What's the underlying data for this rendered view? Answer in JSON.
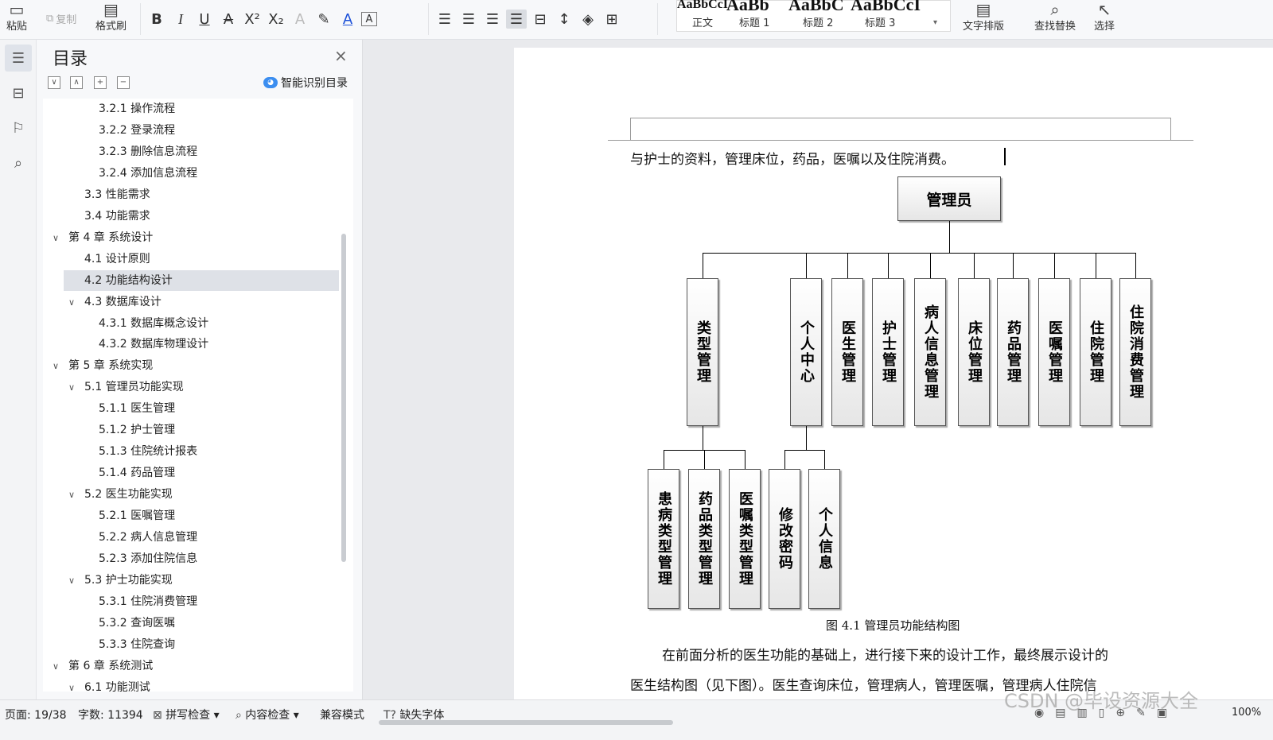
{
  "ribbon": {
    "paste": "粘贴",
    "copy": "复制",
    "format_painter": "格式刷",
    "styles": {
      "previews": [
        "AaBbCcI",
        "AaBb",
        "AaBbC",
        "AaBbCcI"
      ],
      "names": [
        "正文",
        "标题 1",
        "标题 2",
        "标题 3"
      ]
    },
    "text_layout": "文字排版",
    "find_replace": "查找替换",
    "select": "选择"
  },
  "toc": {
    "title": "目录",
    "smart": "智能识别目录",
    "items": [
      {
        "num": "3.2.1",
        "text": "操作流程",
        "level": 3
      },
      {
        "num": "3.2.2",
        "text": "登录流程",
        "level": 3
      },
      {
        "num": "3.2.3",
        "text": "删除信息流程",
        "level": 3
      },
      {
        "num": "3.2.4",
        "text": "添加信息流程",
        "level": 3
      },
      {
        "num": "3.3",
        "text": "性能需求",
        "level": 2
      },
      {
        "num": "3.4",
        "text": "功能需求",
        "level": 2
      },
      {
        "num": "第 4 章",
        "text": "系统设计",
        "level": 1,
        "expanded": true
      },
      {
        "num": "4.1",
        "text": "设计原则",
        "level": 2
      },
      {
        "num": "4.2",
        "text": "功能结构设计",
        "level": 2,
        "selected": true
      },
      {
        "num": "4.3",
        "text": "数据库设计",
        "level": 2,
        "expanded": true
      },
      {
        "num": "4.3.1",
        "text": "数据库概念设计",
        "level": 3
      },
      {
        "num": "4.3.2",
        "text": "数据库物理设计",
        "level": 3
      },
      {
        "num": "第 5 章",
        "text": "系统实现",
        "level": 1,
        "expanded": true
      },
      {
        "num": "5.1",
        "text": "管理员功能实现",
        "level": 2,
        "expanded": true
      },
      {
        "num": "5.1.1",
        "text": "医生管理",
        "level": 3
      },
      {
        "num": "5.1.2",
        "text": "护士管理",
        "level": 3
      },
      {
        "num": "5.1.3",
        "text": "住院统计报表",
        "level": 3
      },
      {
        "num": "5.1.4",
        "text": "药品管理",
        "level": 3
      },
      {
        "num": "5.2",
        "text": "医生功能实现",
        "level": 2,
        "expanded": true
      },
      {
        "num": "5.2.1",
        "text": "医嘱管理",
        "level": 3
      },
      {
        "num": "5.2.2",
        "text": "病人信息管理",
        "level": 3
      },
      {
        "num": "5.2.3",
        "text": "添加住院信息",
        "level": 3
      },
      {
        "num": "5.3",
        "text": "护士功能实现",
        "level": 2,
        "expanded": true
      },
      {
        "num": "5.3.1",
        "text": "住院消费管理",
        "level": 3
      },
      {
        "num": "5.3.2",
        "text": "查询医嘱",
        "level": 3
      },
      {
        "num": "5.3.3",
        "text": "住院查询",
        "level": 3
      },
      {
        "num": "第 6 章",
        "text": "系统测试",
        "level": 1,
        "expanded": true
      },
      {
        "num": "6.1",
        "text": "功能测试",
        "level": 2,
        "expanded": true
      }
    ]
  },
  "doc": {
    "line1": "与护士的资料，管理床位，药品，医嘱以及住院消费。",
    "caption": "图 4.1  管理员功能结构图",
    "para2_line1": "在前面分析的医生功能的基础上，进行接下来的设计工作，最终展示设计的",
    "para2_line2": "医生结构图（见下图）。医生查询床位，管理病人，管理医嘱，管理病人住院信",
    "chart": {
      "root": "管理员",
      "children": [
        "类型管理",
        "个人中心",
        "医生管理",
        "护士管理",
        "病人信息管理",
        "床位管理",
        "药品管理",
        "医嘱管理",
        "住院管理",
        "住院消费管理"
      ],
      "type_children": [
        "患病类型管理",
        "药品类型管理",
        "医嘱类型管理"
      ],
      "center_children": [
        "修改密码",
        "个人信息"
      ]
    }
  },
  "status": {
    "page": "页面: 19/38",
    "words": "字数: 11394",
    "spell": "拼写检查",
    "content": "内容检查",
    "compat": "兼容模式",
    "missing_font": "缺失字体",
    "zoom": "100%"
  },
  "watermark": "CSDN @毕设资源大全"
}
